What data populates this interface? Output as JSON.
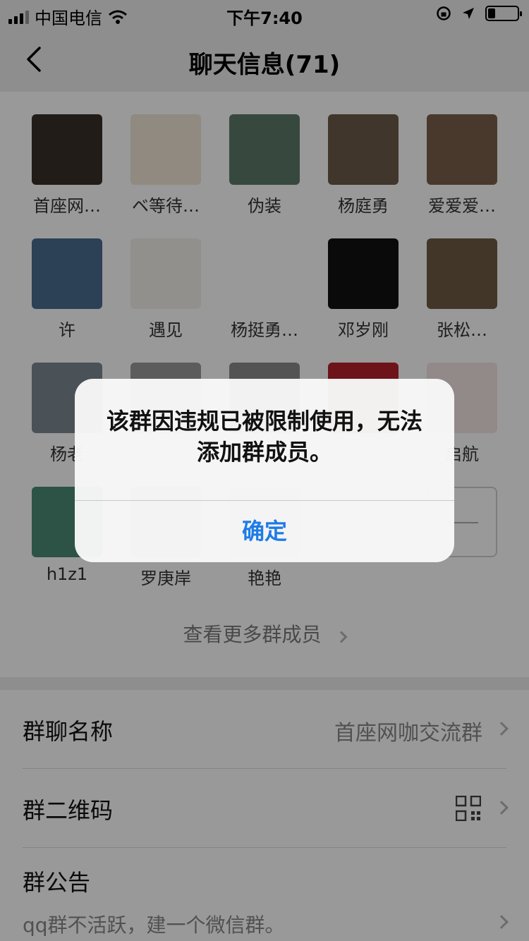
{
  "status_bar": {
    "carrier": "中国电信",
    "time": "下午7:40",
    "battery_level": 0.25
  },
  "nav": {
    "title": "聊天信息(71)",
    "back_icon": "back-arrow-icon"
  },
  "members": [
    {
      "name": "首座网…",
      "color": "#3a2f2a"
    },
    {
      "name": "ベ等待…",
      "color": "#f1e6d6"
    },
    {
      "name": "伪装",
      "color": "#5d7a6a"
    },
    {
      "name": "杨庭勇",
      "color": "#6b5a48"
    },
    {
      "name": "爱爱爱…",
      "color": "#7b5f4c"
    },
    {
      "name": "许",
      "color": "#4a6b8f"
    },
    {
      "name": "遇见",
      "color": "#f4f1ea"
    },
    {
      "name": "杨挺勇…",
      "color": "#ffffff"
    },
    {
      "name": "邓岁刚",
      "color": "#111111"
    },
    {
      "name": "张松…",
      "color": "#6d5a44"
    },
    {
      "name": "杨老",
      "color": "#7c8792"
    },
    {
      "name": "",
      "color": "#9a9a9a"
    },
    {
      "name": "",
      "color": "#8a8a8a"
    },
    {
      "name": "",
      "color": "#b5222c"
    },
    {
      "name": "启航",
      "color": "#f3e7e3"
    },
    {
      "name": "h1z1",
      "color": "#4a8a75"
    },
    {
      "name": "罗庚岸",
      "color": "#d7b49c"
    },
    {
      "name": "艳艳",
      "color": "#c8c8c8"
    }
  ],
  "more_members_label": "查看更多群成员",
  "settings": {
    "group_name_label": "群聊名称",
    "group_name_value": "首座网咖交流群",
    "qr_label": "群二维码",
    "notice_label": "群公告",
    "notice_text": "qq群不活跃，建一个微信群。"
  },
  "alert": {
    "message": "该群因违规已被限制使用，无法添加群成员。",
    "confirm_label": "确定"
  }
}
